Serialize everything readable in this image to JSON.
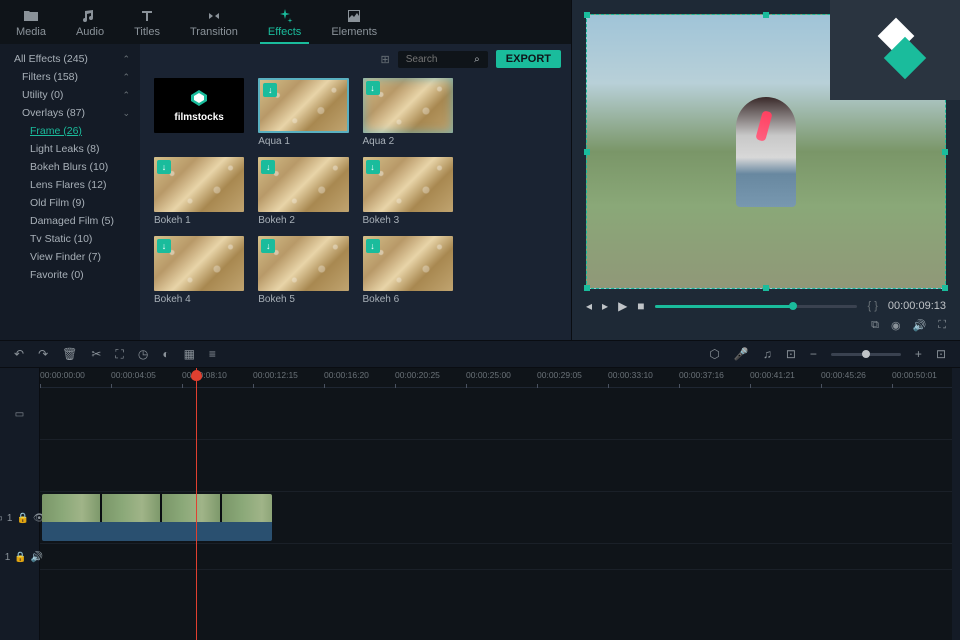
{
  "tabs": [
    {
      "id": "media",
      "label": "Media",
      "icon": "folder"
    },
    {
      "id": "audio",
      "label": "Audio",
      "icon": "music"
    },
    {
      "id": "titles",
      "label": "Titles",
      "icon": "text"
    },
    {
      "id": "transition",
      "label": "Transition",
      "icon": "swap"
    },
    {
      "id": "effects",
      "label": "Effects",
      "icon": "sparkle"
    },
    {
      "id": "elements",
      "label": "Elements",
      "icon": "image"
    }
  ],
  "active_tab": "effects",
  "export_label": "EXPORT",
  "search": {
    "placeholder": "Search"
  },
  "sidebar": {
    "items": [
      {
        "label": "All Effects (245)",
        "indent": 0,
        "chev": "up"
      },
      {
        "label": "Filters (158)",
        "indent": 1,
        "chev": "up"
      },
      {
        "label": "Utility (0)",
        "indent": 1,
        "chev": "up"
      },
      {
        "label": "Overlays (87)",
        "indent": 1,
        "chev": "down"
      },
      {
        "label": "Frame (26)",
        "indent": 2,
        "active": true
      },
      {
        "label": "Light Leaks (8)",
        "indent": 2
      },
      {
        "label": "Bokeh Blurs (10)",
        "indent": 2
      },
      {
        "label": "Lens Flares (12)",
        "indent": 2
      },
      {
        "label": "Old Film (9)",
        "indent": 2
      },
      {
        "label": "Damaged Film (5)",
        "indent": 2
      },
      {
        "label": "Tv Static (10)",
        "indent": 2
      },
      {
        "label": "View Finder (7)",
        "indent": 2
      },
      {
        "label": "Favorite (0)",
        "indent": 2
      }
    ]
  },
  "grid": {
    "filmstocks_label": "filmstocks",
    "items": [
      {
        "label": "",
        "type": "filmstocks"
      },
      {
        "label": "Aqua 1",
        "type": "aqua1"
      },
      {
        "label": "Aqua 2",
        "type": "aqua2"
      },
      {
        "label": "",
        "type": "blank"
      },
      {
        "label": "Bokeh 1",
        "type": "bokeh"
      },
      {
        "label": "Bokeh 2",
        "type": "bokeh"
      },
      {
        "label": "Bokeh 3",
        "type": "bokeh"
      },
      {
        "label": "",
        "type": "blank"
      },
      {
        "label": "Bokeh 4",
        "type": "bokeh"
      },
      {
        "label": "Bokeh 5",
        "type": "bokeh"
      },
      {
        "label": "Bokeh 6",
        "type": "bokeh"
      },
      {
        "label": "",
        "type": "blank"
      }
    ]
  },
  "preview": {
    "timecode": "00:00:09:13",
    "brackets": "{  }"
  },
  "ruler": [
    "00:00:00:00",
    "00:00:04:05",
    "00:00:08:10",
    "00:00:12:15",
    "00:00:16:20",
    "00:00:20:25",
    "00:00:25:00",
    "00:00:29:05",
    "00:00:33:10",
    "00:00:37:16",
    "00:00:41:21",
    "00:00:45:26",
    "00:00:50:01"
  ],
  "track_labels": {
    "video": "1",
    "audio": "1"
  }
}
